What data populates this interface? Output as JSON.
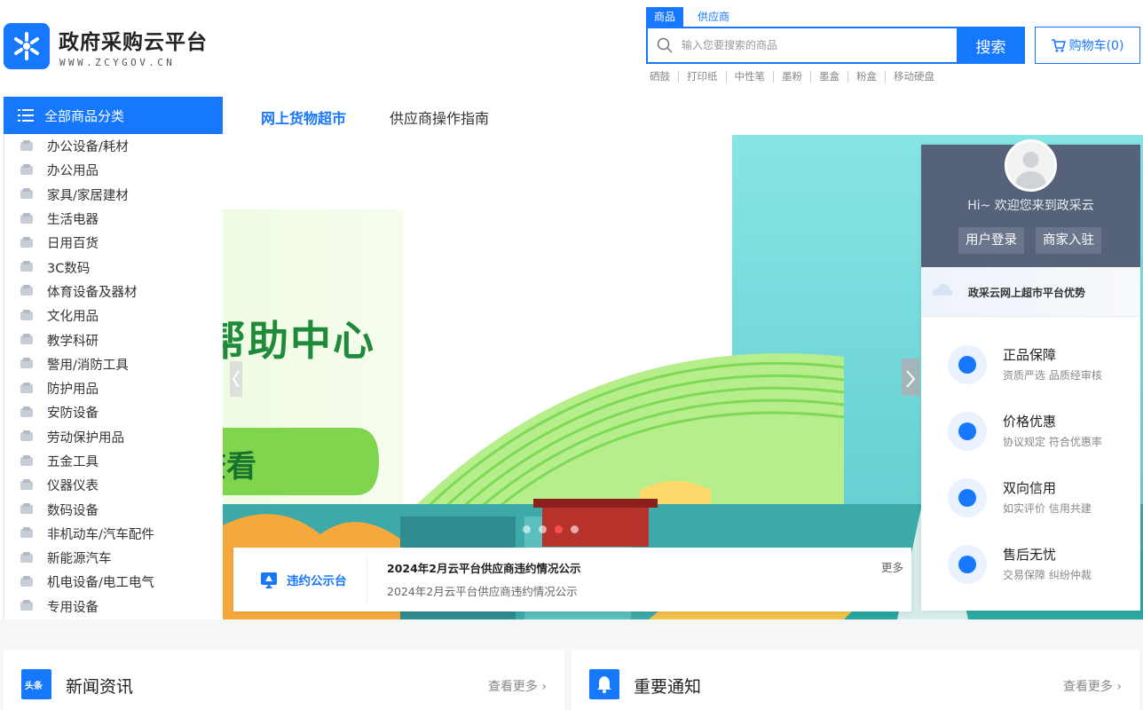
{
  "header": {
    "brand_title": "政府采购云平台",
    "brand_url": "WWW.ZCYGOV.CN",
    "search_tabs": [
      "商品",
      "供应商"
    ],
    "search_placeholder": "输入您要搜索的商品",
    "search_button": "搜索",
    "cart_label": "购物车(0)",
    "hot_keywords": [
      "硒鼓",
      "打印纸",
      "中性笔",
      "墨粉",
      "墨盒",
      "粉盒",
      "移动硬盘"
    ]
  },
  "categories": {
    "header": "全部商品分类",
    "items": [
      {
        "label": "办公设备/耗材",
        "icon": "printer-icon"
      },
      {
        "label": "办公用品",
        "icon": "pen-icon"
      },
      {
        "label": "家具/家居建材",
        "icon": "sofa-icon"
      },
      {
        "label": "生活电器",
        "icon": "fan-icon"
      },
      {
        "label": "日用百货",
        "icon": "bottle-icon"
      },
      {
        "label": "3C数码",
        "icon": "laptop-icon"
      },
      {
        "label": "体育设备及器材",
        "icon": "ball-icon"
      },
      {
        "label": "文化用品",
        "icon": "graduation-cap-icon"
      },
      {
        "label": "教学科研",
        "icon": "microscope-icon"
      },
      {
        "label": "警用/消防工具",
        "icon": "police-cap-icon"
      },
      {
        "label": "防护用品",
        "icon": "shield-icon"
      },
      {
        "label": "安防设备",
        "icon": "security-icon"
      },
      {
        "label": "劳动保护用品",
        "icon": "helmet-icon"
      },
      {
        "label": "五金工具",
        "icon": "tools-icon"
      },
      {
        "label": "仪器仪表",
        "icon": "gauge-icon"
      },
      {
        "label": "数码设备",
        "icon": "camera-icon"
      },
      {
        "label": "非机动车/汽车配件",
        "icon": "parts-icon"
      },
      {
        "label": "新能源汽车",
        "icon": "car-icon"
      },
      {
        "label": "机电设备/电工电气",
        "icon": "motor-icon"
      },
      {
        "label": "专用设备",
        "icon": "monitor-icon"
      }
    ]
  },
  "nav": {
    "market": "网上货物超市",
    "guide": "供应商操作指南"
  },
  "banner": {
    "headline": "帮助中心",
    "cta": "查看",
    "slide_count": 4,
    "active_slide": 2
  },
  "user_panel": {
    "welcome": "Hi~ 欢迎您来到政采云",
    "login": "用户登录",
    "merchant": "商家入驻",
    "advantages_title": "政采云网上超市平台优势",
    "features": [
      {
        "title": "正品保障",
        "desc": "资质严选 品质经审核"
      },
      {
        "title": "价格优惠",
        "desc": "协议规定 符合优惠率"
      },
      {
        "title": "双向信用",
        "desc": "如实评价 信用共建"
      },
      {
        "title": "售后无忧",
        "desc": "交易保障 纠纷仲裁"
      }
    ]
  },
  "notice": {
    "label": "违约公示台",
    "title": "2024年2月云平台供应商违约情况公示",
    "subtitle": "2024年2月云平台供应商违约情况公示",
    "more": "更多"
  },
  "bottom": {
    "news_title": "新闻资讯",
    "news_icon_text": "头条",
    "notice_title": "重要通知",
    "more": "查看更多"
  },
  "colors": {
    "primary": "#1677ff",
    "user_panel_bg": "#566279",
    "banner_green": "#7ed957",
    "banner_teal": "#7de0e0"
  }
}
